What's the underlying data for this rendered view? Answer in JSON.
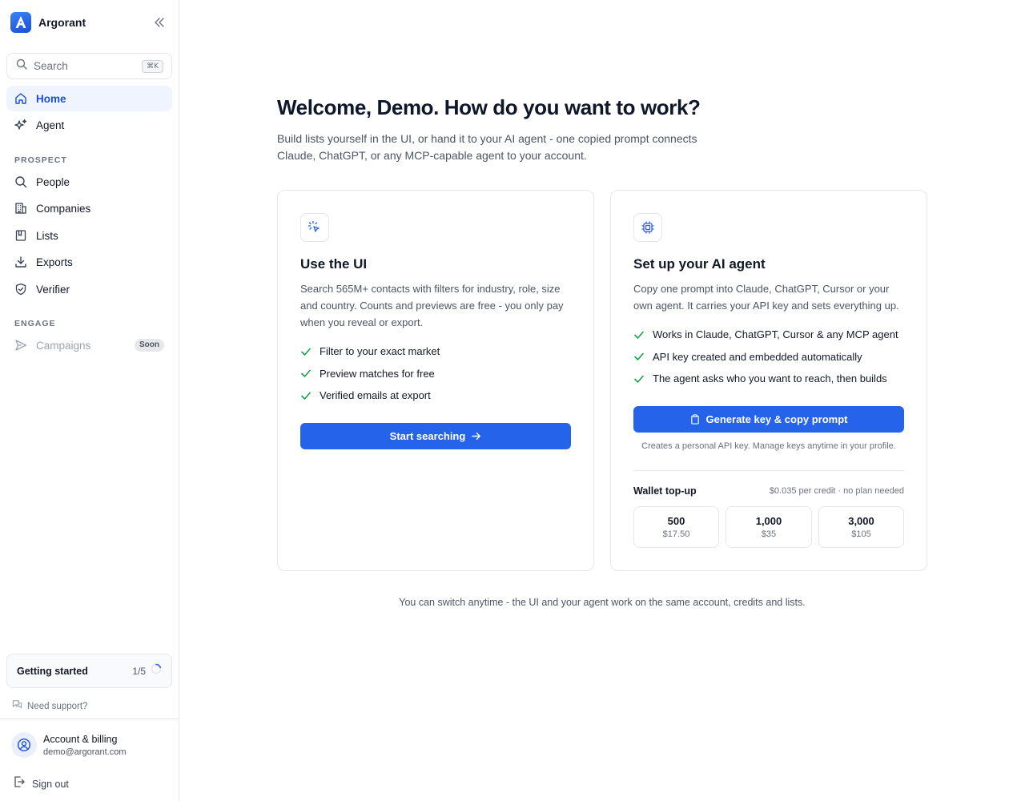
{
  "app": {
    "name": "Argorant"
  },
  "sidebar": {
    "search": {
      "placeholder": "Search",
      "shortcut": "⌘K"
    },
    "nav_main": [
      {
        "label": "Home",
        "icon": "home-icon",
        "active": true
      },
      {
        "label": "Agent",
        "icon": "sparkles-icon"
      }
    ],
    "sections": {
      "prospect": "PROSPECT",
      "engage": "ENGAGE"
    },
    "nav_prospect": [
      {
        "label": "People",
        "icon": "search-icon"
      },
      {
        "label": "Companies",
        "icon": "building-icon"
      },
      {
        "label": "Lists",
        "icon": "book-icon"
      },
      {
        "label": "Exports",
        "icon": "download-icon"
      },
      {
        "label": "Verifier",
        "icon": "shield-check-icon"
      }
    ],
    "nav_engage": [
      {
        "label": "Campaigns",
        "icon": "send-icon",
        "badge": "Soon",
        "disabled": true
      }
    ],
    "getting_started": {
      "title": "Getting started",
      "progress": "1/5",
      "fraction": 0.2
    },
    "support": "Need support?",
    "account": {
      "title": "Account & billing",
      "email": "demo@argorant.com"
    },
    "sign_out": "Sign out"
  },
  "main": {
    "title": "Welcome, Demo. How do you want to work?",
    "subtitle": "Build lists yourself in the UI, or hand it to your AI agent - one copied prompt connects Claude, ChatGPT, or any MCP-capable agent to your account.",
    "ui_card": {
      "title": "Use the UI",
      "description": "Search 565M+ contacts with filters for industry, role, size and country. Counts and previews are free - you only pay when you reveal or export.",
      "checks": [
        "Filter to your exact market",
        "Preview matches for free",
        "Verified emails at export"
      ],
      "button": "Start searching"
    },
    "agent_card": {
      "title": "Set up your AI agent",
      "description": "Copy one prompt into Claude, ChatGPT, Cursor or your own agent. It carries your API key and sets everything up.",
      "checks": [
        "Works in Claude, ChatGPT, Cursor & any MCP agent",
        "API key created and embedded automatically",
        "The agent asks who you want to reach, then builds"
      ],
      "button": "Generate key & copy prompt",
      "helper": "Creates a personal API key. Manage keys anytime in your profile.",
      "wallet_title": "Wallet top-up",
      "wallet_rate": "$0.035 per credit · no plan needed",
      "topups": [
        {
          "credits": "500",
          "price": "$17.50"
        },
        {
          "credits": "1,000",
          "price": "$35"
        },
        {
          "credits": "3,000",
          "price": "$105"
        }
      ]
    },
    "footer": "You can switch anytime - the UI and your agent work on the same account, credits and lists."
  },
  "colors": {
    "accent": "#2563eb",
    "check": "#16a34a",
    "active_bg": "#eff4ff"
  }
}
